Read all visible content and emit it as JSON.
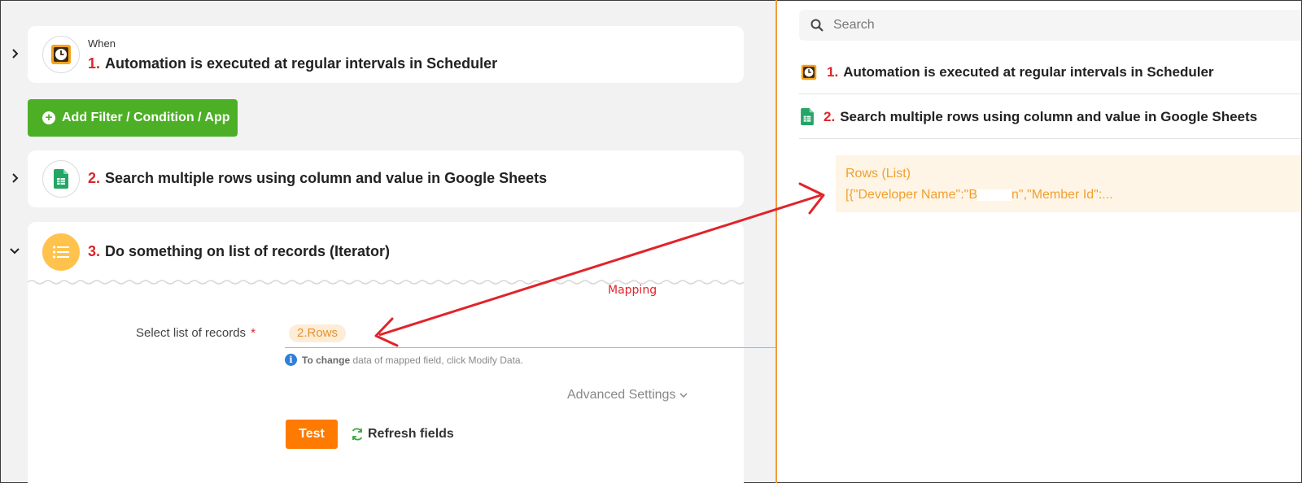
{
  "workflow": {
    "steps": [
      {
        "number": "1.",
        "prefix": "When",
        "label": "Automation is executed at regular intervals in Scheduler",
        "icon": "scheduler-clock-icon",
        "expanded": false
      },
      {
        "number": "2.",
        "label": "Search multiple rows using column and value in Google Sheets",
        "icon": "google-sheets-icon",
        "expanded": false
      },
      {
        "number": "3.",
        "label": "Do something on list of records (Iterator)",
        "icon": "list-icon",
        "expanded": true
      }
    ],
    "add_button_label": "Add Filter / Condition / App",
    "iterator": {
      "field_label": "Select list of records",
      "required_mark": "*",
      "mapped_value": "2.Rows",
      "hint_bold": "To change",
      "hint_rest": "data of mapped field, click Modify Data.",
      "advanced_label": "Advanced Settings",
      "test_label": "Test",
      "refresh_label": "Refresh fields"
    }
  },
  "annotation": {
    "text": "Mapping",
    "color": "#e0242a"
  },
  "data_panel": {
    "search_placeholder": "Search",
    "items": [
      {
        "number": "1.",
        "label": "Automation is executed at regular intervals in Scheduler",
        "icon": "scheduler-clock-icon"
      },
      {
        "number": "2.",
        "label": "Search multiple rows using column and value in Google Sheets",
        "icon": "google-sheets-icon"
      }
    ],
    "result": {
      "title": "Rows (List)",
      "value_start": "[{\"Developer Name\":\"B",
      "value_end": "n\",\"Member Id\":..."
    }
  },
  "colors": {
    "accent_orange": "#ff7a00",
    "add_green": "#4caf26",
    "step_number_red": "#e0242a",
    "divider_orange": "#f39a3c",
    "pill_text": "#e8922a"
  }
}
